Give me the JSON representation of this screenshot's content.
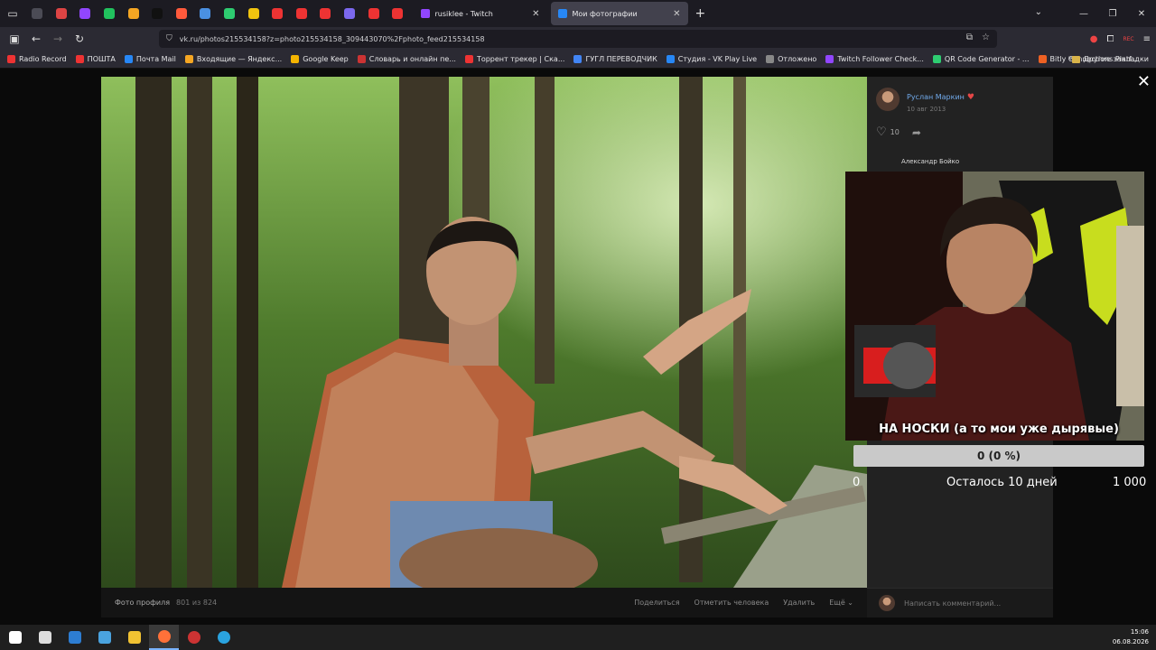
{
  "browser": {
    "tabs": [
      {
        "title": "rusiklee - Twitch",
        "favicon_color": "#9146ff",
        "active": false
      },
      {
        "title": "Мои фотографии",
        "favicon_color": "#2787f5",
        "active": true
      }
    ],
    "pinned_colors": [
      "#4b4b55",
      "#d44",
      "#9146ff",
      "#21c25e",
      "#f5a623",
      "#111",
      "#ff5a3c",
      "#4a90e2",
      "#2ecc71",
      "#f1c40f",
      "#e33",
      "#e33",
      "#e33",
      "#7b68ee",
      "#e33",
      "#e33"
    ],
    "url": "vk.ru/photos215534158?z=photo215534158_309443070%2Fphoto_feed215534158",
    "extension_badge": "REC",
    "bookmarks": [
      {
        "label": "Radio Record",
        "color": "#e33"
      },
      {
        "label": "ПОШТА",
        "color": "#e33"
      },
      {
        "label": "Почта Mail",
        "color": "#2787f5"
      },
      {
        "label": "Входящие — Яндекс...",
        "color": "#f5a623"
      },
      {
        "label": "Google Keep",
        "color": "#f4b400"
      },
      {
        "label": "Словарь и онлайн пе...",
        "color": "#c33"
      },
      {
        "label": "Торрент трекер | Ска...",
        "color": "#e33"
      },
      {
        "label": "ГУГЛ ПЕРЕВОДЧИК",
        "color": "#4285f4"
      },
      {
        "label": "Студия - VK Play Live",
        "color": "#2787f5"
      },
      {
        "label": "Отложено",
        "color": "#888"
      },
      {
        "label": "Twitch Follower Check...",
        "color": "#9146ff"
      },
      {
        "label": "QR Code Generator - ...",
        "color": "#2ecc71"
      },
      {
        "label": "Bitly Connections Platf...",
        "color": "#ee6123"
      }
    ],
    "other_bookmarks": "Другие закладки"
  },
  "viewer": {
    "author": "Руслан Маркин",
    "date": "10 авг 2013",
    "likes": "10",
    "commenter": "Александр Бойко",
    "footer_label": "Фото профиля",
    "footer_count": "801 из 824",
    "actions": [
      "Поделиться",
      "Отметить человека",
      "Удалить",
      "Ещё ⌄"
    ],
    "comment_placeholder": "Написать комментарий..."
  },
  "overlay": {
    "goal_title": "НА НОСКИ (а то мои уже дырявые)",
    "goal_progress_text": "0 (0 %)",
    "goal_progress": 0,
    "goal_min": "0",
    "goal_remaining": "Осталось 10 дней",
    "goal_max": "1 000"
  },
  "taskbar": {
    "time": "15:06",
    "date": "06.08.2026",
    "icons": [
      {
        "name": "windows-start-icon",
        "color": "#fff"
      },
      {
        "name": "task-view-icon",
        "color": "#ddd"
      },
      {
        "name": "calculator-icon",
        "color": "#2d7dd2"
      },
      {
        "name": "store-icon",
        "color": "#4aa3df"
      },
      {
        "name": "file-explorer-icon",
        "color": "#f1c232"
      },
      {
        "name": "firefox-icon",
        "color": "#ff7139"
      },
      {
        "name": "obs-icon",
        "color": "#c33"
      },
      {
        "name": "telegram-icon",
        "color": "#2aa3df"
      }
    ]
  }
}
